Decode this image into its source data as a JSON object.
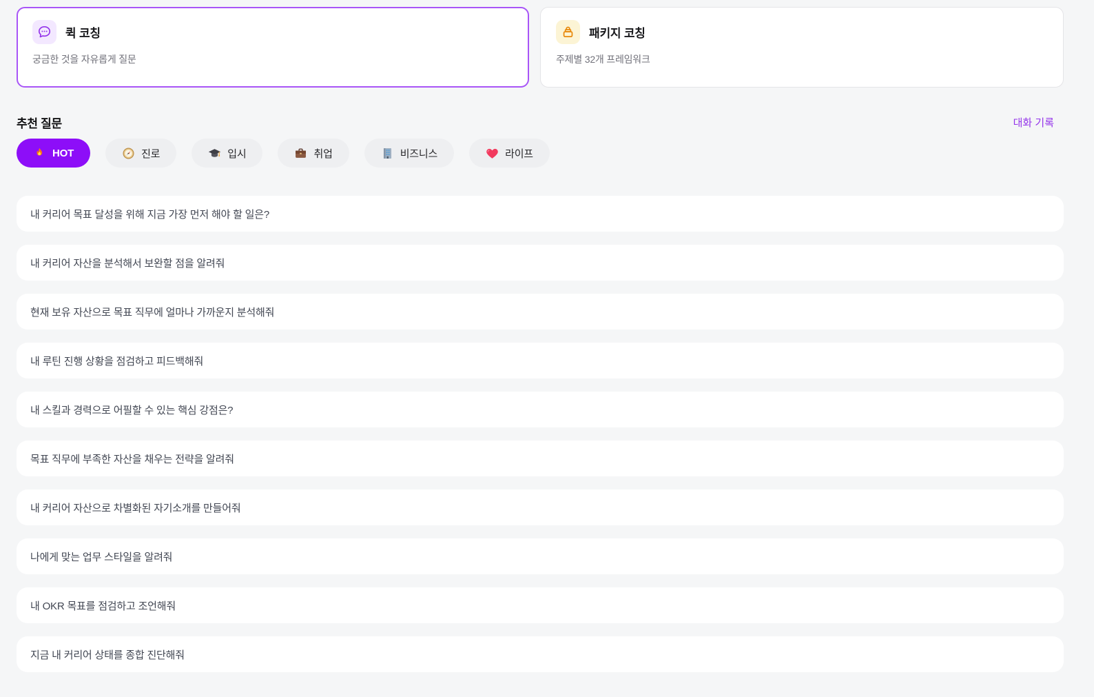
{
  "mode_cards": [
    {
      "title": "퀵 코칭",
      "subtitle": "궁금한 것을 자유롭게 질문",
      "icon": "chat-bubble-icon",
      "selected": true
    },
    {
      "title": "패키지 코칭",
      "subtitle": "주제별 32개 프레임워크",
      "icon": "bag-icon",
      "selected": false
    }
  ],
  "section": {
    "title": "추천 질문",
    "history_link": "대화 기록"
  },
  "filters": [
    {
      "label": "HOT",
      "icon": "fire-icon",
      "active": true
    },
    {
      "label": "진로",
      "icon": "compass-icon",
      "active": false
    },
    {
      "label": "입시",
      "icon": "graduation-cap-icon",
      "active": false
    },
    {
      "label": "취업",
      "icon": "briefcase-icon",
      "active": false
    },
    {
      "label": "비즈니스",
      "icon": "office-building-icon",
      "active": false
    },
    {
      "label": "라이프",
      "icon": "heart-icon",
      "active": false
    }
  ],
  "questions": [
    "내 커리어 목표 달성을 위해 지금 가장 먼저 해야 할 일은?",
    "내 커리어 자산을 분석해서 보완할 점을 알려줘",
    "현재 보유 자산으로 목표 직무에 얼마나 가까운지 분석해줘",
    "내 루틴 진행 상황을 점검하고 피드백해줘",
    "내 스킬과 경력으로 어필할 수 있는 핵심 강점은?",
    "목표 직무에 부족한 자산을 채우는 전략을 알려줘",
    "내 커리어 자산으로 차별화된 자기소개를 만들어줘",
    "나에게 맞는 업무 스타일을 알려줘",
    "내 OKR 목표를 점검하고 조언해줘",
    "지금 내 커리어 상태를 종합 진단해줘"
  ],
  "colors": {
    "page_background": "#F5F6F7",
    "accent_purple": "#8D0EF8",
    "selected_border_purple": "#A855F7",
    "link_purple": "#9333EA",
    "quick_icon_purple": "#9333EA",
    "quick_icon_bg": "#F3E8FF",
    "package_icon_orange": "#E8890C",
    "package_icon_bg": "#FCF4D5",
    "chip_background": "#EEEFF1",
    "card_background": "#FFFFFF",
    "question_text": "#414652",
    "subtitle_text": "#71717A"
  }
}
